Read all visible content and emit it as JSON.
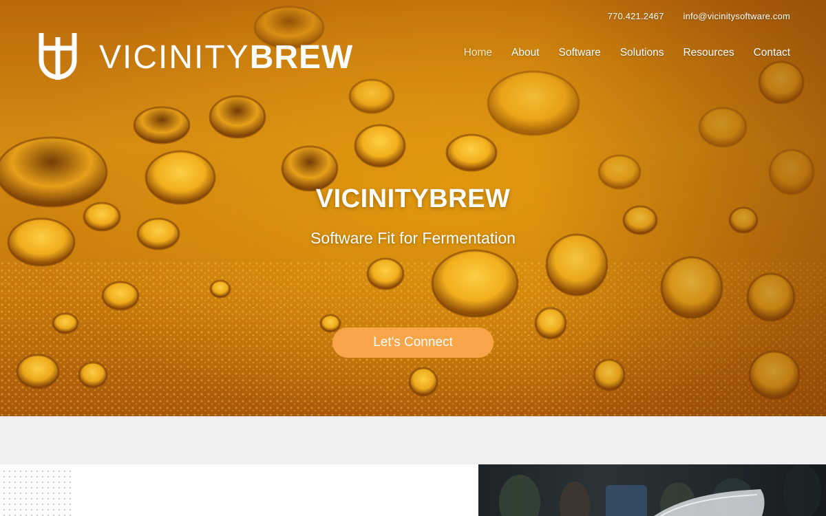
{
  "contact": {
    "phone": "770.421.2467",
    "email": "info@vicinitysoftware.com"
  },
  "logo": {
    "text_light": "VICINITY",
    "text_bold": "BREW"
  },
  "nav": {
    "items": [
      {
        "label": "Home",
        "active": true
      },
      {
        "label": "About"
      },
      {
        "label": "Software"
      },
      {
        "label": "Solutions"
      },
      {
        "label": "Resources"
      },
      {
        "label": "Contact"
      }
    ]
  },
  "hero": {
    "title": "VICINITYBREW",
    "subtitle": "Software Fit for Fermentation",
    "cta_label": "Let's Connect"
  },
  "colors": {
    "accent": "#f9a64a",
    "hero_amber": "#d38a12",
    "band_gray": "#efefef"
  }
}
